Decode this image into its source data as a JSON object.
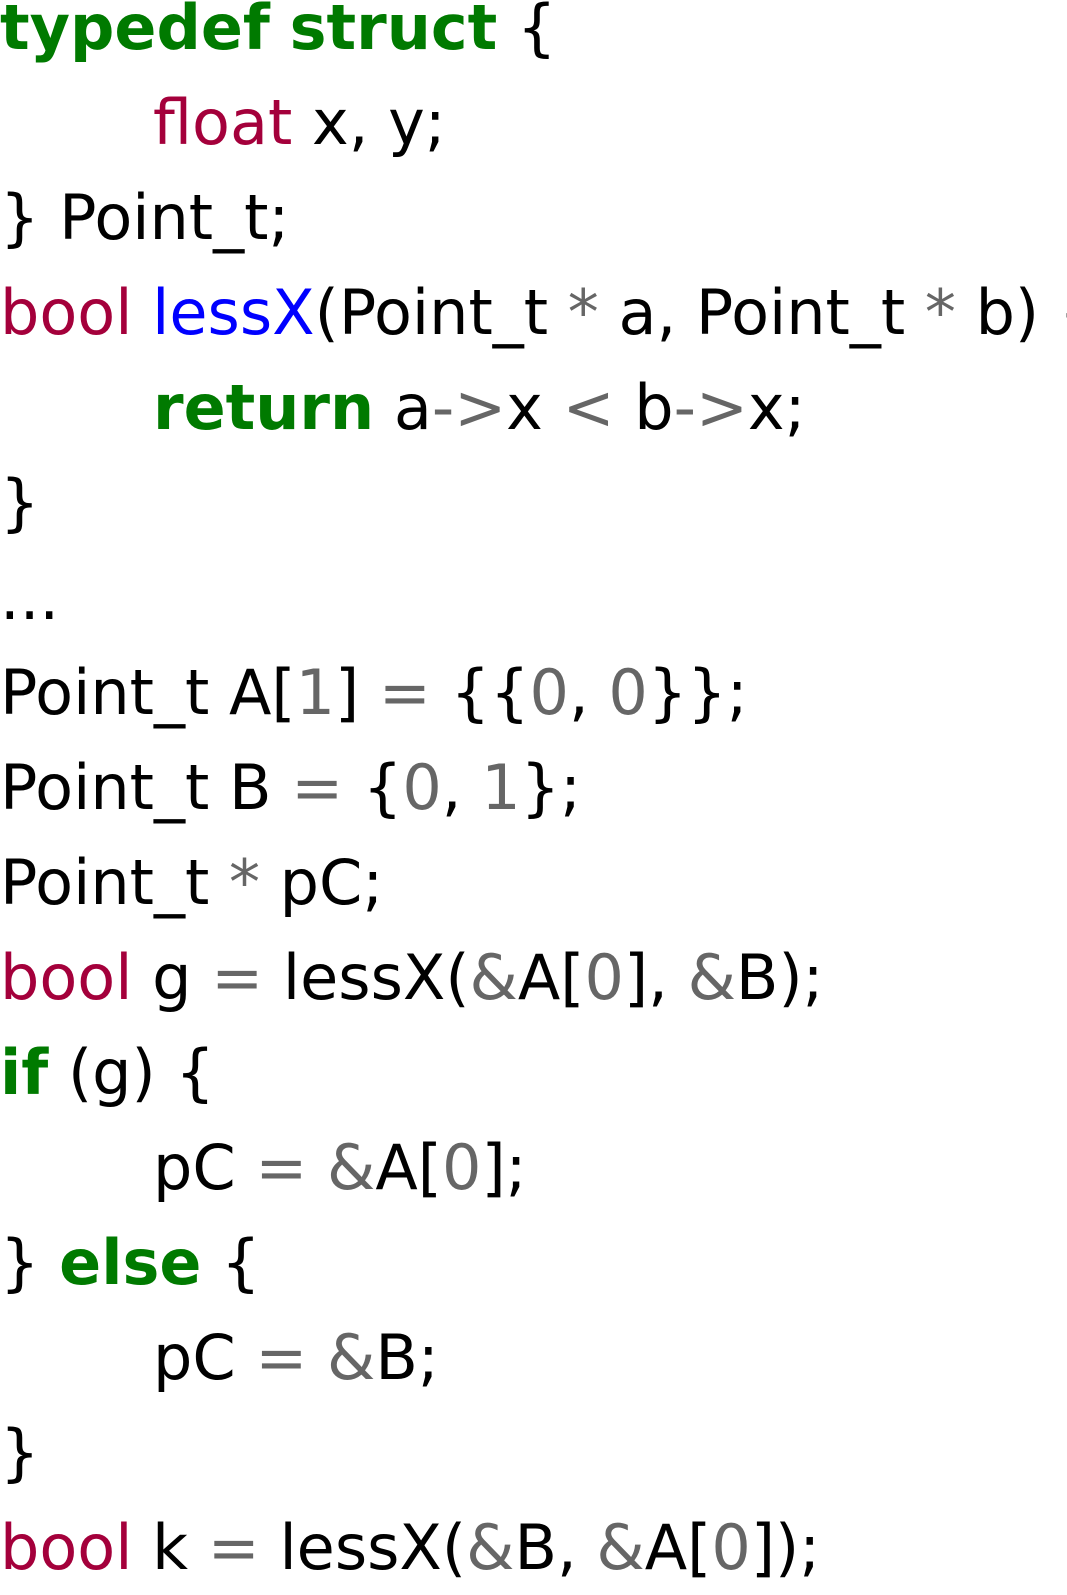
{
  "palette": {
    "keyword": "#007a00",
    "type": "#a4003b",
    "function": "#0000ff",
    "operator": "#666666",
    "number": "#666666",
    "plain": "#000000"
  },
  "lines": [
    {
      "indent": 0,
      "tokens": [
        {
          "t": "typedef",
          "c": "keyword"
        },
        {
          "t": " "
        },
        {
          "t": "struct",
          "c": "keyword"
        },
        {
          "t": " {"
        }
      ]
    },
    {
      "indent": 1,
      "tokens": [
        {
          "t": "float",
          "c": "type"
        },
        {
          "t": " x, y;"
        }
      ]
    },
    {
      "indent": 0,
      "tokens": [
        {
          "t": "} Point_t;"
        }
      ]
    },
    {
      "indent": 0,
      "tokens": [
        {
          "t": "bool",
          "c": "type"
        },
        {
          "t": " "
        },
        {
          "t": "lessX",
          "c": "function"
        },
        {
          "t": "(Point_t "
        },
        {
          "t": "*",
          "c": "operator"
        },
        {
          "t": " a, Point_t "
        },
        {
          "t": "*",
          "c": "operator"
        },
        {
          "t": " b) {"
        }
      ]
    },
    {
      "indent": 1,
      "tokens": [
        {
          "t": "return",
          "c": "keyword"
        },
        {
          "t": " a"
        },
        {
          "t": "->",
          "c": "operator"
        },
        {
          "t": "x "
        },
        {
          "t": "<",
          "c": "operator"
        },
        {
          "t": " b"
        },
        {
          "t": "->",
          "c": "operator"
        },
        {
          "t": "x;"
        }
      ]
    },
    {
      "indent": 0,
      "tokens": [
        {
          "t": "}"
        }
      ]
    },
    {
      "indent": 0,
      "tokens": [
        {
          "t": "..."
        }
      ]
    },
    {
      "indent": 0,
      "tokens": [
        {
          "t": "Point_t A["
        },
        {
          "t": "1",
          "c": "number"
        },
        {
          "t": "] "
        },
        {
          "t": "=",
          "c": "operator"
        },
        {
          "t": " {{"
        },
        {
          "t": "0",
          "c": "number"
        },
        {
          "t": ", "
        },
        {
          "t": "0",
          "c": "number"
        },
        {
          "t": "}};"
        }
      ]
    },
    {
      "indent": 0,
      "tokens": [
        {
          "t": "Point_t B "
        },
        {
          "t": "=",
          "c": "operator"
        },
        {
          "t": " {"
        },
        {
          "t": "0",
          "c": "number"
        },
        {
          "t": ", "
        },
        {
          "t": "1",
          "c": "number"
        },
        {
          "t": "};"
        }
      ]
    },
    {
      "indent": 0,
      "tokens": [
        {
          "t": "Point_t "
        },
        {
          "t": "*",
          "c": "operator"
        },
        {
          "t": " pC;"
        }
      ]
    },
    {
      "indent": 0,
      "tokens": [
        {
          "t": "bool",
          "c": "type"
        },
        {
          "t": " g "
        },
        {
          "t": "=",
          "c": "operator"
        },
        {
          "t": " lessX("
        },
        {
          "t": "&",
          "c": "operator"
        },
        {
          "t": "A["
        },
        {
          "t": "0",
          "c": "number"
        },
        {
          "t": "], "
        },
        {
          "t": "&",
          "c": "operator"
        },
        {
          "t": "B);"
        }
      ]
    },
    {
      "indent": 0,
      "tokens": [
        {
          "t": "if",
          "c": "keyword"
        },
        {
          "t": " (g) {"
        }
      ]
    },
    {
      "indent": 1,
      "tokens": [
        {
          "t": "pC "
        },
        {
          "t": "=",
          "c": "operator"
        },
        {
          "t": " "
        },
        {
          "t": "&",
          "c": "operator"
        },
        {
          "t": "A["
        },
        {
          "t": "0",
          "c": "number"
        },
        {
          "t": "];"
        }
      ]
    },
    {
      "indent": 0,
      "tokens": [
        {
          "t": "} "
        },
        {
          "t": "else",
          "c": "keyword"
        },
        {
          "t": " {"
        }
      ]
    },
    {
      "indent": 1,
      "tokens": [
        {
          "t": "pC "
        },
        {
          "t": "=",
          "c": "operator"
        },
        {
          "t": " "
        },
        {
          "t": "&",
          "c": "operator"
        },
        {
          "t": "B;"
        }
      ]
    },
    {
      "indent": 0,
      "tokens": [
        {
          "t": "}"
        }
      ]
    },
    {
      "indent": 0,
      "tokens": [
        {
          "t": "bool",
          "c": "type"
        },
        {
          "t": " k "
        },
        {
          "t": "=",
          "c": "operator"
        },
        {
          "t": " lessX("
        },
        {
          "t": "&",
          "c": "operator"
        },
        {
          "t": "B, "
        },
        {
          "t": "&",
          "c": "operator"
        },
        {
          "t": "A["
        },
        {
          "t": "0",
          "c": "number"
        },
        {
          "t": "]);"
        }
      ]
    }
  ]
}
